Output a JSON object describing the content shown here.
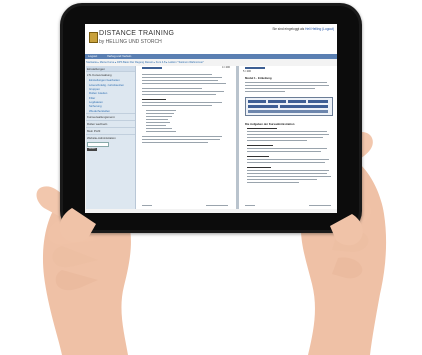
{
  "brand": {
    "title": "DISTANCE TRAINING",
    "subtitle": "by HELLING UND STORCH"
  },
  "login": {
    "text": "Sie sind eingeloggt als",
    "user": "Heli Helling (Logout)"
  },
  "nav": [
    "Logout",
    "Verlag und Verlein"
  ],
  "breadcrumb": "Startseite ▸ Meine Kurse ▸ DPS Basic Der Regung Ressor ▸ Kurs 4.8 ▸ Lektion \"Testimon Wahnsinner\"",
  "sidebar": {
    "heading": "Einstellungen",
    "sections": [
      {
        "label": "LTL Kursverwaltung",
        "items": [
          "Einstellungen bearbeiten",
          "Lösen/Anleitg. zurücksetzen",
          "Gruppen",
          "Rollen zuteilen",
          "Filter",
          "Logdateien",
          "Sicherung",
          "Wiederherstellen"
        ]
      },
      {
        "label": "Kursverwaltungsmenü"
      },
      {
        "label": "Rollen wechseln"
      },
      {
        "label": "Mein Profil"
      },
      {
        "label": "Website-Administration"
      }
    ],
    "search_button": "Suchen"
  },
  "pages": {
    "left_num": "4 / 200",
    "right_num": "5 / 200",
    "right_heading_1": "Modul 1 · Einleitung",
    "right_heading_2": "Die Aufgaben der Kursadministration"
  },
  "colors": {
    "navbar": "#5a7fb2",
    "sidebar": "#dde7f0",
    "tablet": "#1a1a1a",
    "skin": "#f2c7ad"
  }
}
